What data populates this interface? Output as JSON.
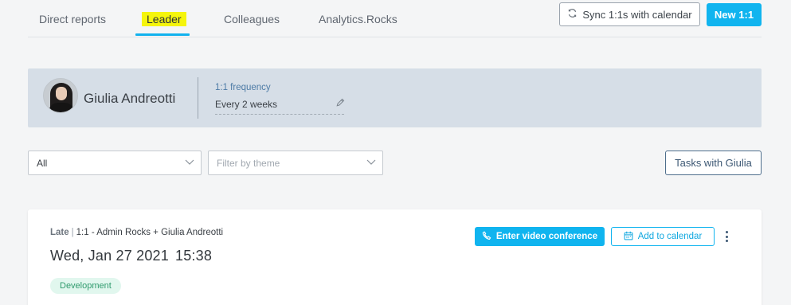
{
  "tabs": [
    {
      "label": "Direct reports",
      "active": false
    },
    {
      "label": "Leader",
      "active": true
    },
    {
      "label": "Colleagues",
      "active": false
    },
    {
      "label": "Analytics.Rocks",
      "active": false
    }
  ],
  "header": {
    "sync_label": "Sync 1:1s with calendar",
    "new_label": "New 1:1"
  },
  "profile": {
    "name": "Giulia Andreotti",
    "frequency_label": "1:1 frequency",
    "frequency_value": "Every 2 weeks"
  },
  "filters": {
    "scope_value": "All",
    "theme_placeholder": "Filter by theme",
    "tasks_label": "Tasks with Giulia"
  },
  "meeting": {
    "status": "Late",
    "title": "1:1 - Admin Rocks + Giulia Andreotti",
    "date": "Wed, Jan 27 2021",
    "time": "15:38",
    "tag": "Development",
    "video_label": "Enter video conference",
    "calendar_label": "Add to calendar"
  },
  "colors": {
    "accent": "#10b4ef",
    "highlight": "#f5f50c",
    "profile_bg": "#d6dee7",
    "tag_bg": "#e1f7ee",
    "tag_text": "#2e9a6c"
  },
  "icons": {
    "sync": "sync-icon",
    "edit": "pencil-icon",
    "dropdown": "chevron-down-icon",
    "phone": "phone-icon",
    "calendar": "calendar-icon",
    "more": "kebab-menu-icon"
  }
}
